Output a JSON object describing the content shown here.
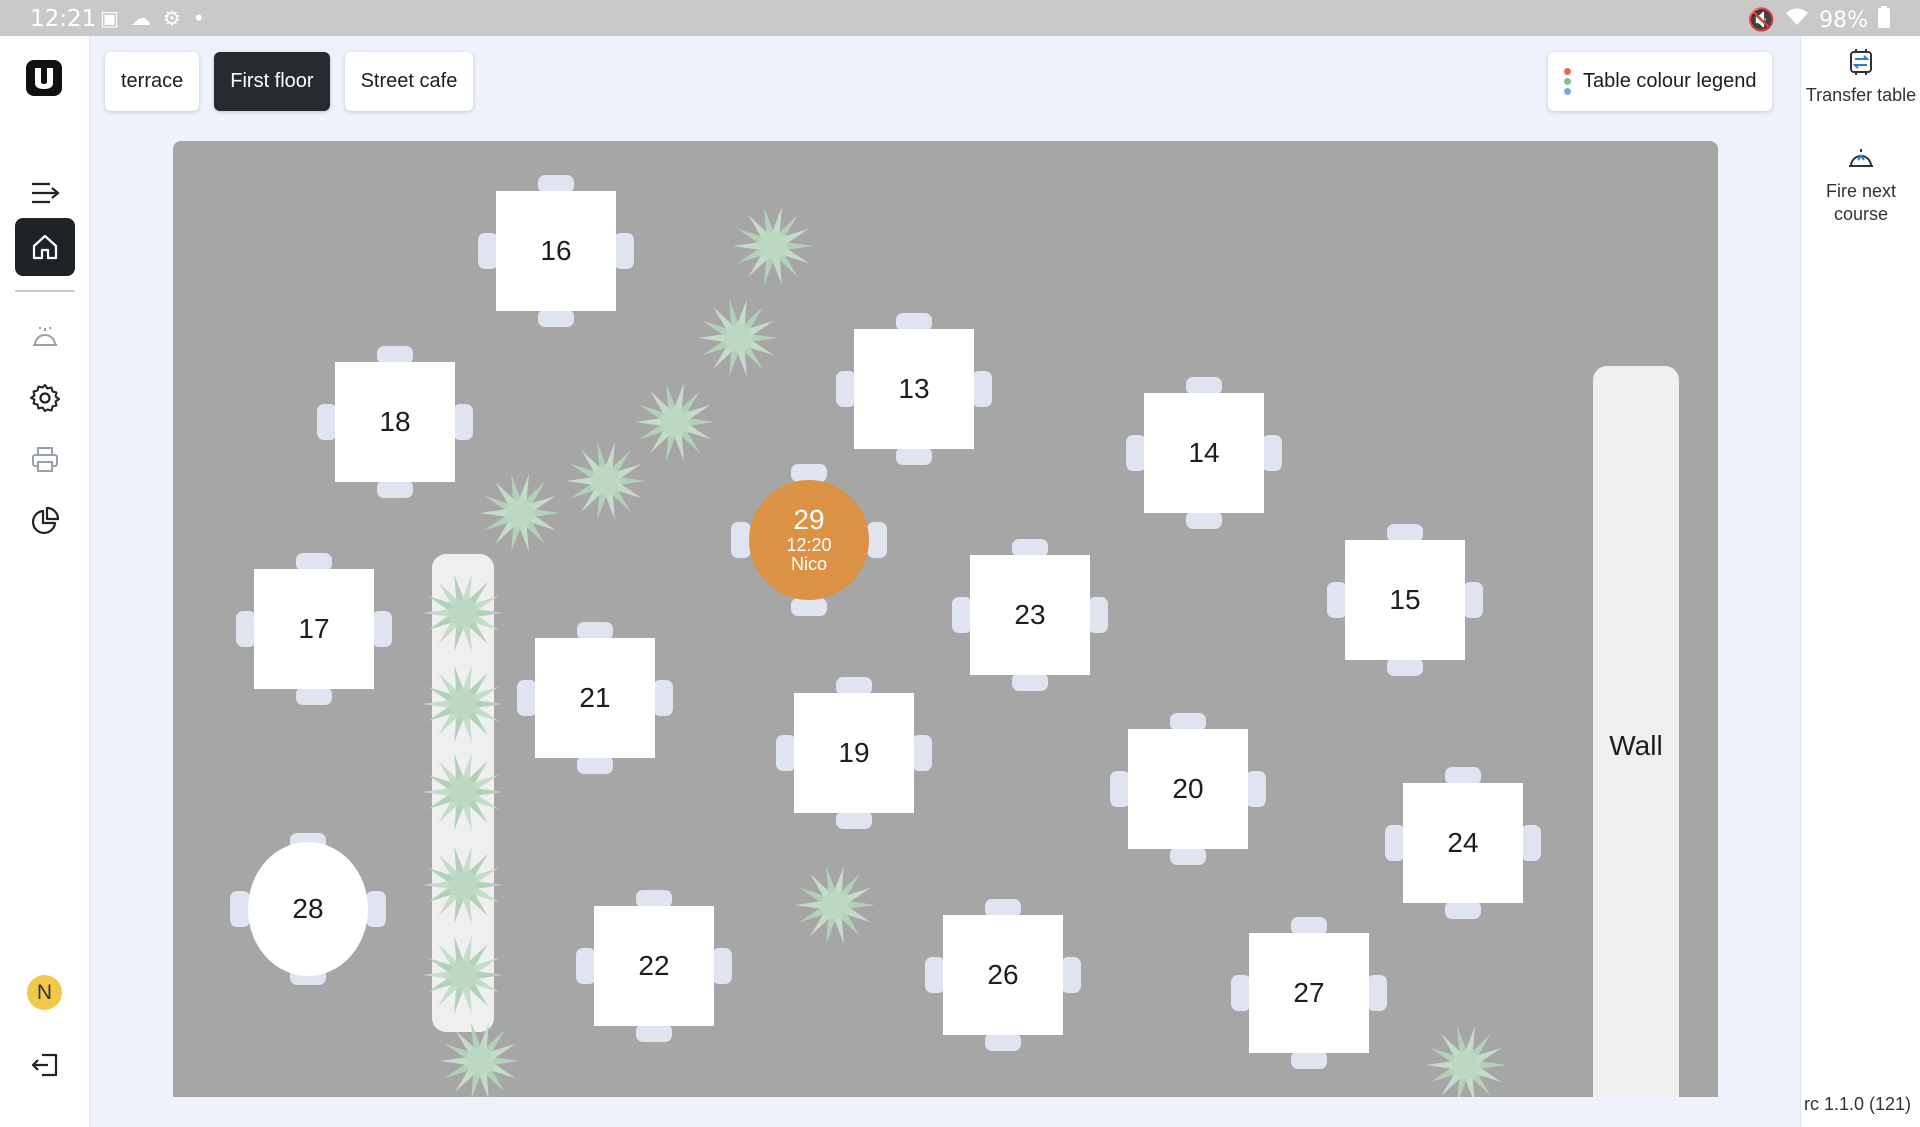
{
  "status_bar": {
    "time": "12:21",
    "battery": "98%"
  },
  "tabs": [
    {
      "label": "terrace",
      "active": false
    },
    {
      "label": "First floor",
      "active": true
    },
    {
      "label": "Street cafe",
      "active": false
    }
  ],
  "legend_button": {
    "label": "Table colour legend",
    "colors": [
      "#e06a5a",
      "#7fc08f",
      "#7aa9d8"
    ]
  },
  "right_actions": {
    "transfer": "Transfer table",
    "fire_next": "Fire next course"
  },
  "version": "rc 1.1.0 (121)",
  "user": {
    "initial": "N"
  },
  "floor": {
    "wall_label": "Wall",
    "tables": [
      {
        "number": "16",
        "shape": "square"
      },
      {
        "number": "18",
        "shape": "square"
      },
      {
        "number": "13",
        "shape": "square"
      },
      {
        "number": "14",
        "shape": "square"
      },
      {
        "number": "29",
        "shape": "round",
        "occupied": true,
        "time": "12:20",
        "waiter": "Nico"
      },
      {
        "number": "17",
        "shape": "square"
      },
      {
        "number": "23",
        "shape": "square"
      },
      {
        "number": "15",
        "shape": "square"
      },
      {
        "number": "21",
        "shape": "square"
      },
      {
        "number": "19",
        "shape": "square"
      },
      {
        "number": "20",
        "shape": "square"
      },
      {
        "number": "24",
        "shape": "square"
      },
      {
        "number": "28",
        "shape": "round"
      },
      {
        "number": "22",
        "shape": "square"
      },
      {
        "number": "26",
        "shape": "square"
      },
      {
        "number": "27",
        "shape": "square"
      }
    ]
  }
}
